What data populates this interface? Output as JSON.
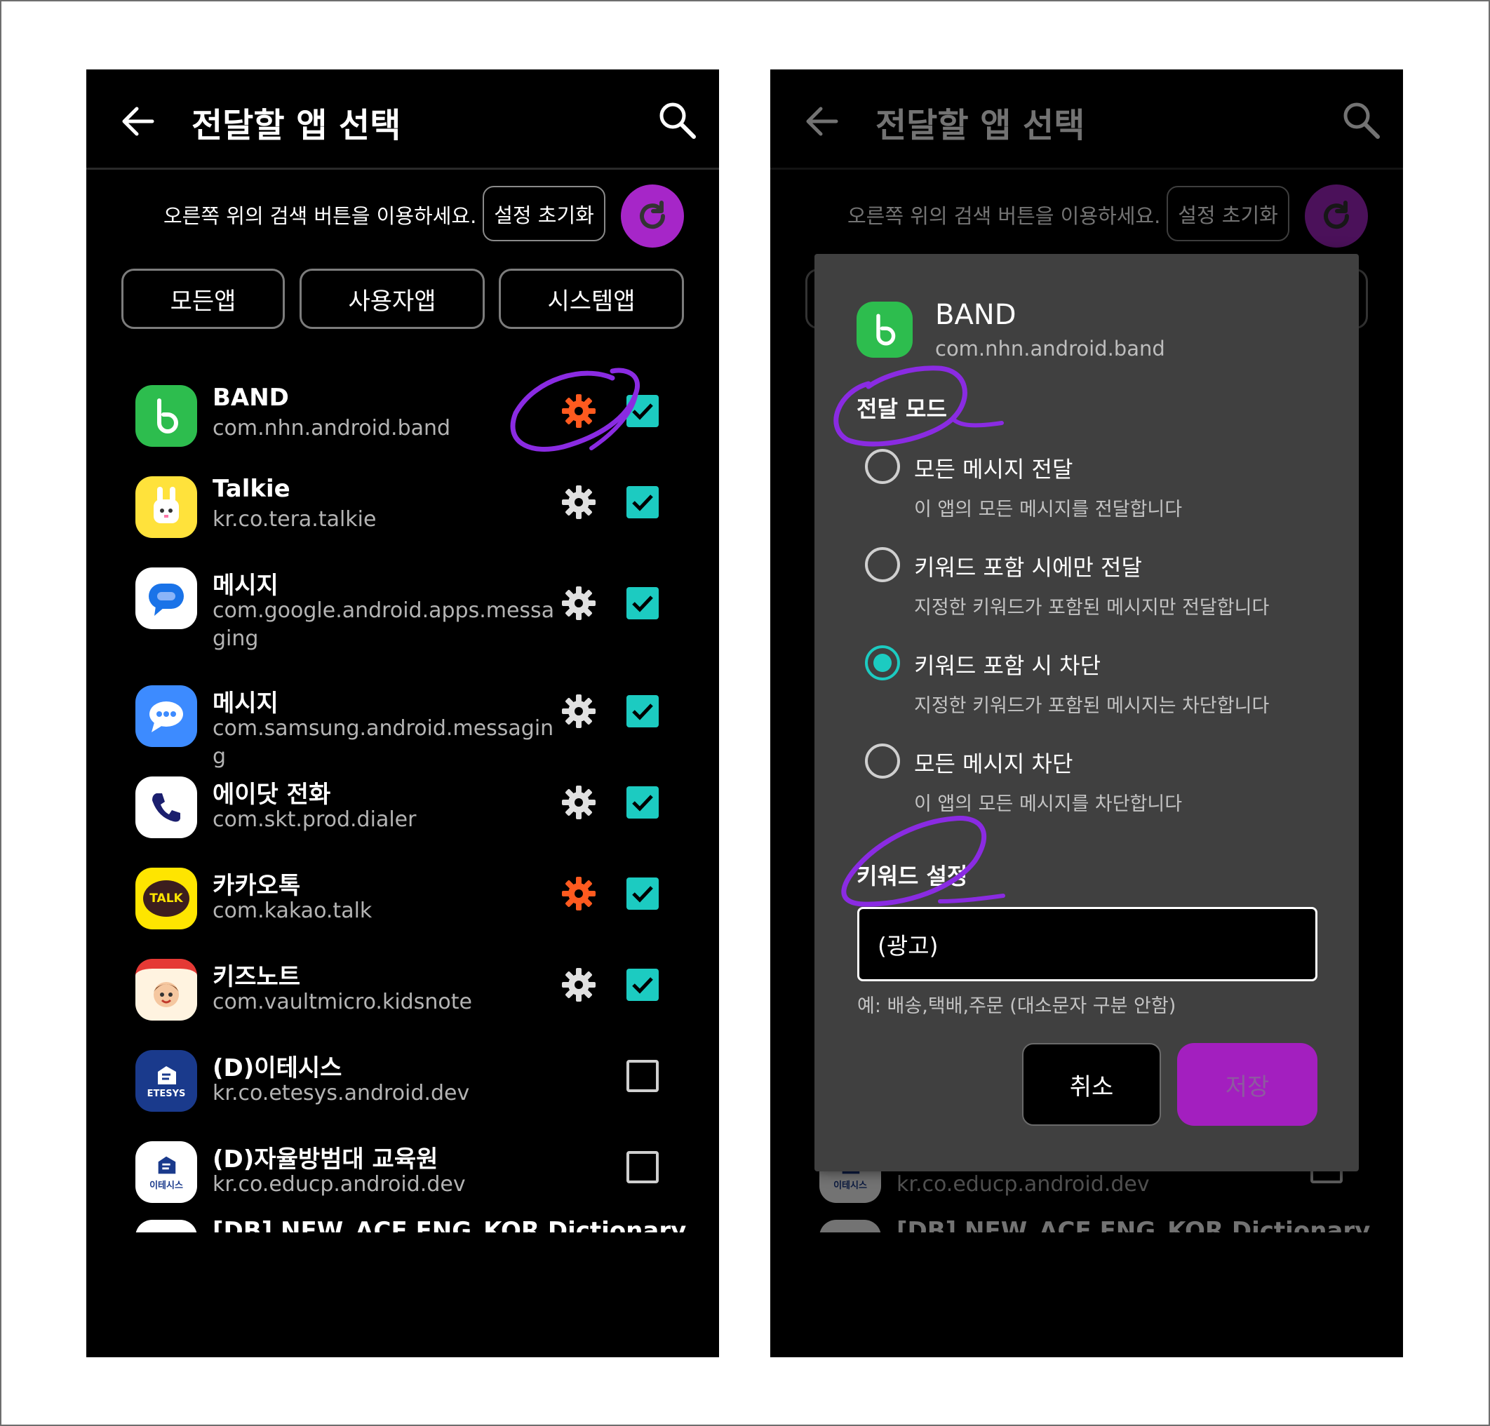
{
  "screen": {
    "title": "전달할 앱 선택",
    "hint": "오른쪽 위의 검색 버튼을 이용하세요.",
    "reset_label": "설정 초기화",
    "filters": [
      "모든앱",
      "사용자앱",
      "시스템앱"
    ]
  },
  "apps": [
    {
      "name": "BAND",
      "package": "com.nhn.android.band",
      "gear": "active",
      "checked": true
    },
    {
      "name": "Talkie",
      "package": "kr.co.tera.talkie",
      "gear": "normal",
      "checked": true
    },
    {
      "name": "메시지",
      "package": "com.google.android.apps.messaging",
      "gear": "normal",
      "checked": true
    },
    {
      "name": "메시지",
      "package": "com.samsung.android.messaging",
      "gear": "normal",
      "checked": true
    },
    {
      "name": "에이닷 전화",
      "package": "com.skt.prod.dialer",
      "gear": "normal",
      "checked": true
    },
    {
      "name": "카카오톡",
      "package": "com.kakao.talk",
      "gear": "active",
      "checked": true
    },
    {
      "name": "키즈노트",
      "package": "com.vaultmicro.kidsnote",
      "gear": "normal",
      "checked": true
    },
    {
      "name": "(D)이테시스",
      "package": "kr.co.etesys.android.dev",
      "gear": "none",
      "checked": false
    },
    {
      "name": "(D)자율방범대 교육원",
      "package": "kr.co.educp.android.dev",
      "gear": "none",
      "checked": false
    },
    {
      "name": "[DB] NEW_ACE ENG_KOR Dictionary",
      "package": "",
      "gear": "none",
      "checked": false
    }
  ],
  "icon_labels": {
    "talk": "TALK",
    "etesys": "ETESYS",
    "etesys_kr": "이테시스"
  },
  "dialog": {
    "app_name": "BAND",
    "app_package": "com.nhn.android.band",
    "mode_label": "전달 모드",
    "options": [
      {
        "label": "모든 메시지 전달",
        "desc": "이 앱의 모든 메시지를 전달합니다",
        "selected": false
      },
      {
        "label": "키워드 포함 시에만 전달",
        "desc": "지정한 키워드가 포함된 메시지만 전달합니다",
        "selected": false
      },
      {
        "label": "키워드 포함 시 차단",
        "desc": "지정한 키워드가 포함된 메시지는 차단합니다",
        "selected": true
      },
      {
        "label": "모든 메시지 차단",
        "desc": "이 앱의 모든 메시지를 차단합니다",
        "selected": false
      }
    ],
    "keyword_label": "키워드 설정",
    "keyword_value": "(광고)",
    "keyword_hint": "예: 배송,택배,주문 (대소문자 구분 안함)",
    "cancel_label": "취소",
    "save_label": "저장"
  },
  "colors": {
    "accent_purple": "#a626c8",
    "check_teal": "#1ccbc1",
    "gear_orange": "#ff5a1f",
    "annotation_purple": "#8a2be2"
  }
}
